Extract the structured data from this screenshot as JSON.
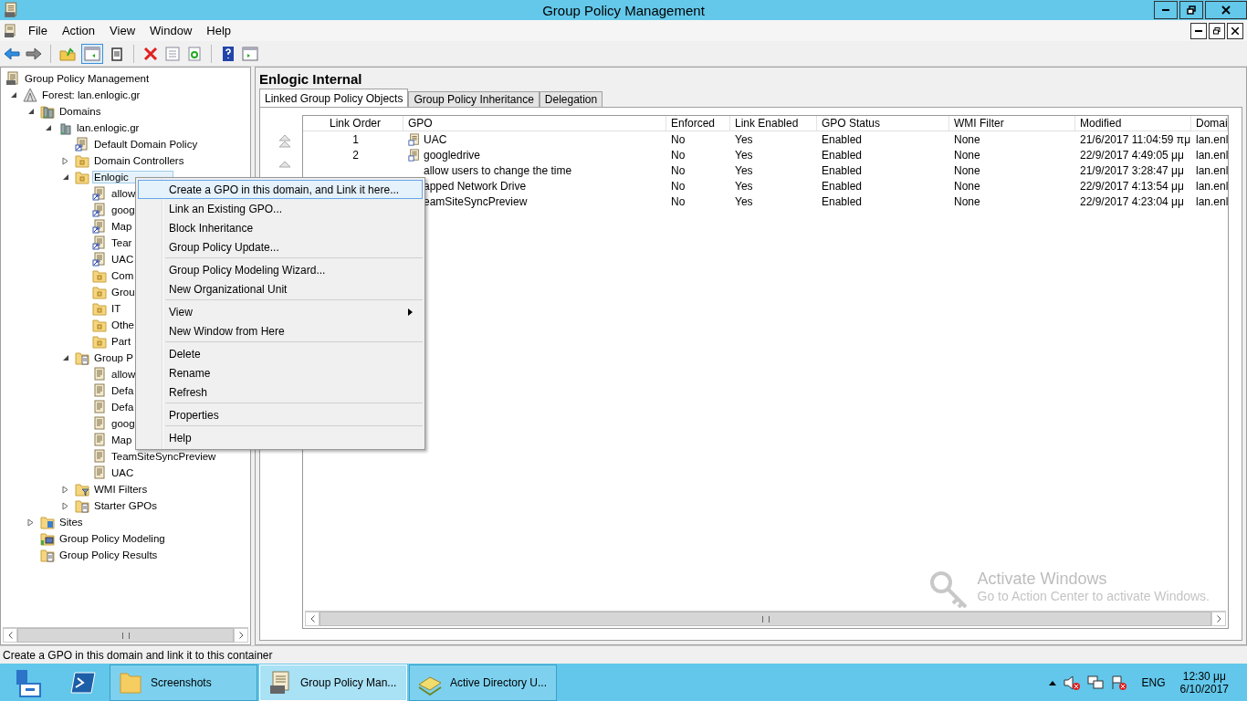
{
  "window": {
    "title": "Group Policy Management"
  },
  "menu_bar": [
    "File",
    "Action",
    "View",
    "Window",
    "Help"
  ],
  "tree": [
    {
      "label": "Group Policy Management",
      "kind": "root",
      "children": [
        {
          "label": "Forest: lan.enlogic.gr",
          "kind": "forest",
          "expanded": true,
          "children": [
            {
              "label": "Domains",
              "kind": "domains",
              "expanded": true,
              "children": [
                {
                  "label": "lan.enlogic.gr",
                  "kind": "domain",
                  "expanded": true,
                  "children": [
                    {
                      "label": "Default Domain Policy",
                      "kind": "gpo-link"
                    },
                    {
                      "label": "Domain Controllers",
                      "kind": "ou",
                      "expanded": false
                    },
                    {
                      "label": "Enlogic",
                      "kind": "ou",
                      "expanded": true,
                      "selected": true,
                      "children": [
                        {
                          "label": "allow",
                          "kind": "gpo-link"
                        },
                        {
                          "label": "goog",
                          "kind": "gpo-link"
                        },
                        {
                          "label": "Map",
                          "kind": "gpo-link"
                        },
                        {
                          "label": "Tear",
                          "kind": "gpo-link"
                        },
                        {
                          "label": "UAC",
                          "kind": "gpo-link"
                        },
                        {
                          "label": "Com",
                          "kind": "ou"
                        },
                        {
                          "label": "Grou",
                          "kind": "ou"
                        },
                        {
                          "label": "IT",
                          "kind": "ou"
                        },
                        {
                          "label": "Othe",
                          "kind": "ou"
                        },
                        {
                          "label": "Part",
                          "kind": "ou"
                        }
                      ]
                    },
                    {
                      "label": "Group P",
                      "kind": "gpo-folder",
                      "expanded": true,
                      "children": [
                        {
                          "label": "allow",
                          "kind": "gpo"
                        },
                        {
                          "label": "Defa",
                          "kind": "gpo"
                        },
                        {
                          "label": "Defa",
                          "kind": "gpo"
                        },
                        {
                          "label": "goog",
                          "kind": "gpo"
                        },
                        {
                          "label": "Map",
                          "kind": "gpo"
                        },
                        {
                          "label": "TeamSiteSyncPreview",
                          "kind": "gpo"
                        },
                        {
                          "label": "UAC",
                          "kind": "gpo"
                        }
                      ]
                    },
                    {
                      "label": "WMI Filters",
                      "kind": "wmi",
                      "expanded": false
                    },
                    {
                      "label": "Starter GPOs",
                      "kind": "starter",
                      "expanded": false
                    }
                  ]
                }
              ]
            },
            {
              "label": "Sites",
              "kind": "sites",
              "expanded": false
            },
            {
              "label": "Group Policy Modeling",
              "kind": "modeling"
            },
            {
              "label": "Group Policy Results",
              "kind": "results"
            }
          ]
        }
      ]
    }
  ],
  "pane": {
    "title": "Enlogic Internal",
    "tabs": [
      {
        "label": "Linked Group Policy Objects",
        "selected": true
      },
      {
        "label": "Group Policy Inheritance",
        "selected": false
      },
      {
        "label": "Delegation",
        "selected": false
      }
    ],
    "table": {
      "columns": [
        "Link Order",
        "GPO",
        "Enforced",
        "Link Enabled",
        "GPO Status",
        "WMI Filter",
        "Modified",
        "Domai"
      ],
      "rows": [
        [
          "1",
          "UAC",
          "No",
          "Yes",
          "Enabled",
          "None",
          "21/6/2017 11:04:59 πμ",
          "lan.enl"
        ],
        [
          "2",
          "googledrive",
          "No",
          "Yes",
          "Enabled",
          "None",
          "22/9/2017 4:49:05 μμ",
          "lan.enl"
        ],
        [
          "",
          "allow users to change the time",
          "No",
          "Yes",
          "Enabled",
          "None",
          "21/9/2017 3:28:47 μμ",
          "lan.enl"
        ],
        [
          "",
          "apped Network Drive",
          "No",
          "Yes",
          "Enabled",
          "None",
          "22/9/2017 4:13:54 μμ",
          "lan.enl"
        ],
        [
          "",
          "eamSiteSyncPreview",
          "No",
          "Yes",
          "Enabled",
          "None",
          "22/9/2017 4:23:04 μμ",
          "lan.enl"
        ]
      ]
    }
  },
  "context_menu": [
    [
      {
        "label": "Create a GPO in this domain, and Link it here...",
        "selected": true
      },
      {
        "label": "Link an Existing GPO...",
        "selected": false
      },
      {
        "label": "Block Inheritance",
        "selected": false
      },
      {
        "label": "Group Policy Update...",
        "selected": false
      }
    ],
    [
      {
        "label": "Group Policy Modeling Wizard...",
        "selected": false
      },
      {
        "label": "New Organizational Unit",
        "selected": false
      }
    ],
    [
      {
        "label": "View",
        "selected": false,
        "kind": "submenu"
      },
      {
        "label": "New Window from Here",
        "selected": false
      }
    ],
    [
      {
        "label": "Delete",
        "selected": false
      },
      {
        "label": "Rename",
        "selected": false
      },
      {
        "label": "Refresh",
        "selected": false
      }
    ],
    [
      {
        "label": "Properties",
        "selected": false
      }
    ],
    [
      {
        "label": "Help",
        "selected": false
      }
    ]
  ],
  "activation": {
    "title": "Activate Windows",
    "text": "Go to Action Center to activate Windows."
  },
  "status_bar": "Create a GPO in this domain and link it to this container",
  "taskbar": {
    "buttons": [
      {
        "label": "Screenshots",
        "kind": "folder",
        "selected": false
      },
      {
        "label": "Group Policy Man...",
        "kind": "gpm",
        "selected": true
      },
      {
        "label": "Active Directory U...",
        "kind": "ad",
        "selected": false
      }
    ],
    "language": "ENG",
    "time": "12:30 μμ",
    "date": "6/10/2017"
  }
}
